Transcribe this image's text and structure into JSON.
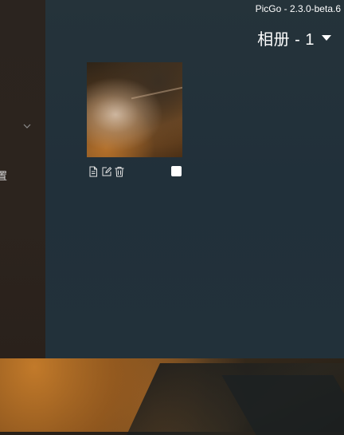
{
  "app": {
    "title": "PicGo - 2.3.0-beta.6"
  },
  "gallery": {
    "title": "相册 - 1"
  },
  "sidebar": {
    "partial_label": "置"
  },
  "colors": {
    "accent": "#409eff",
    "main_bg": "#25333a",
    "sidebar_bg": "#2b241f"
  },
  "icons": {
    "copy": "document-icon",
    "edit": "edit-icon",
    "delete": "trash-icon",
    "dropdown": "caret-down-icon",
    "collapse": "chevron-down-icon"
  },
  "cards": [
    {
      "selected": false
    }
  ]
}
